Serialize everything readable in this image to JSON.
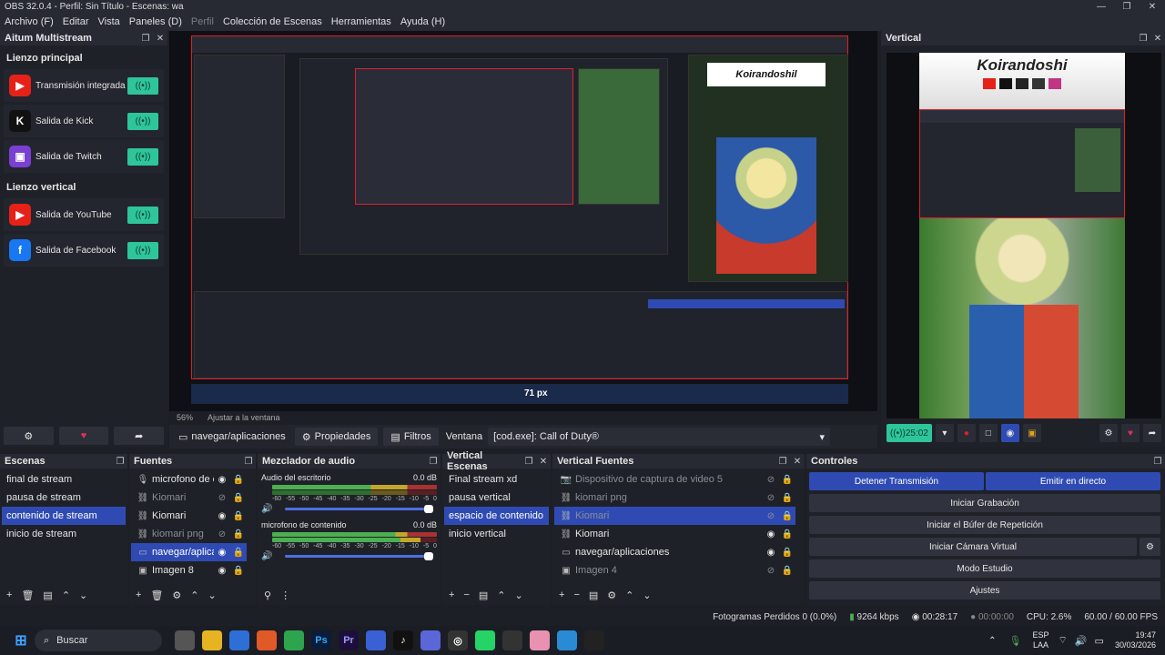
{
  "window": {
    "title": "OBS 32.0.4 - Perfil: Sin Título - Escenas: wa",
    "minimize": "—",
    "maximize": "❐",
    "close": "✕"
  },
  "menu": [
    "Archivo (F)",
    "Editar",
    "Vista",
    "Paneles (D)",
    "Perfil",
    "Colección de Escenas",
    "Herramientas",
    "Ayuda (H)"
  ],
  "aitum": {
    "title": "Aitum Multistream",
    "section1": "Lienzo principal",
    "items1": [
      {
        "label": "Transmisión integrada",
        "icon": "youtube-icon",
        "color": "#e62117",
        "glyph": "▶"
      },
      {
        "label": "Salida de Kick",
        "icon": "kick-icon",
        "color": "#111111",
        "glyph": "K"
      },
      {
        "label": "Salida de Twitch",
        "icon": "twitch-icon",
        "color": "#7a3fd3",
        "glyph": "▣"
      }
    ],
    "section2": "Lienzo vertical",
    "items2": [
      {
        "label": "Salida de YouTube",
        "icon": "youtube-icon",
        "color": "#e62117",
        "glyph": "▶"
      },
      {
        "label": "Salida de Facebook",
        "icon": "facebook-icon",
        "color": "#1877f2",
        "glyph": "f"
      }
    ],
    "toggle": "((•))"
  },
  "preview": {
    "zoom": "56%",
    "fit": "Ajustar a la ventana",
    "overlay_text": "71 px"
  },
  "sourcebar": {
    "source": "navegar/aplicaciones",
    "props": "Propiedades",
    "filters": "Filtros",
    "window_label": "Ventana",
    "window_value": "[cod.exe]: Call of Duty®"
  },
  "vertical": {
    "title": "Vertical",
    "banner": "Koirandoshi",
    "timer": "25:02"
  },
  "scenes": {
    "title": "Escenas",
    "items": [
      "final de stream",
      "pausa de stream",
      "contenido de stream",
      "inicio de stream"
    ],
    "selected": 2
  },
  "sources": {
    "title": "Fuentes",
    "items": [
      {
        "name": "microfono de cor",
        "icon": "🎙",
        "dim": false
      },
      {
        "name": "Kiomari",
        "icon": "⛓",
        "dim": true
      },
      {
        "name": "Kiomari",
        "icon": "⛓",
        "dim": false
      },
      {
        "name": "kiomari png",
        "icon": "⛓",
        "dim": true
      },
      {
        "name": "navegar/aplicacic",
        "icon": "▭",
        "dim": false,
        "sel": true
      },
      {
        "name": "Imagen 8",
        "icon": "▣",
        "dim": false
      }
    ]
  },
  "mixer": {
    "title": "Mezclador de audio",
    "tracks": [
      {
        "name": "Audio del escritorio",
        "db": "0.0 dB"
      },
      {
        "name": "microfono de contenido",
        "db": "0.0 dB"
      }
    ],
    "scale": [
      "-60",
      "-55",
      "-50",
      "-45",
      "-40",
      "-35",
      "-30",
      "-25",
      "-20",
      "-15",
      "-10",
      "-5",
      "0"
    ]
  },
  "vscenes": {
    "title": "Vertical Escenas",
    "items": [
      "Final stream xd",
      "pausa vertical",
      "espacio de contenido",
      "inicio vertical"
    ],
    "selected": 2
  },
  "vsources": {
    "title": "Vertical Fuentes",
    "items": [
      {
        "name": "Dispositivo de captura de video 5",
        "icon": "📷",
        "dim": true
      },
      {
        "name": "kiomari png",
        "icon": "⛓",
        "dim": true
      },
      {
        "name": "Kiomari",
        "icon": "⛓",
        "dim": true,
        "sel": true
      },
      {
        "name": "Kiomari",
        "icon": "⛓",
        "dim": false
      },
      {
        "name": "navegar/aplicaciones",
        "icon": "▭",
        "dim": false
      },
      {
        "name": "Imagen 4",
        "icon": "▣",
        "dim": true
      }
    ]
  },
  "controls": {
    "title": "Controles",
    "stop": "Detener Transmisión",
    "emit": "Emitir en directo",
    "rec": "Iniciar Grabación",
    "replay": "Iniciar el Búfer de Repetición",
    "vcam": "Iniciar Cámara Virtual",
    "studio": "Modo Estudio",
    "settings": "Ajustes"
  },
  "status": {
    "dropped": "Fotogramas Perdidos 0 (0.0%)",
    "kbps": "9264 kbps",
    "stream_time": "00:28:17",
    "rec_time": "00:00:00",
    "cpu": "CPU: 2.6%",
    "fps": "60.00 / 60.00 FPS"
  },
  "taskbar": {
    "search": "Buscar",
    "lang1": "ESP",
    "lang2": "LAA",
    "time": "19:47",
    "date": "30/03/2026"
  }
}
